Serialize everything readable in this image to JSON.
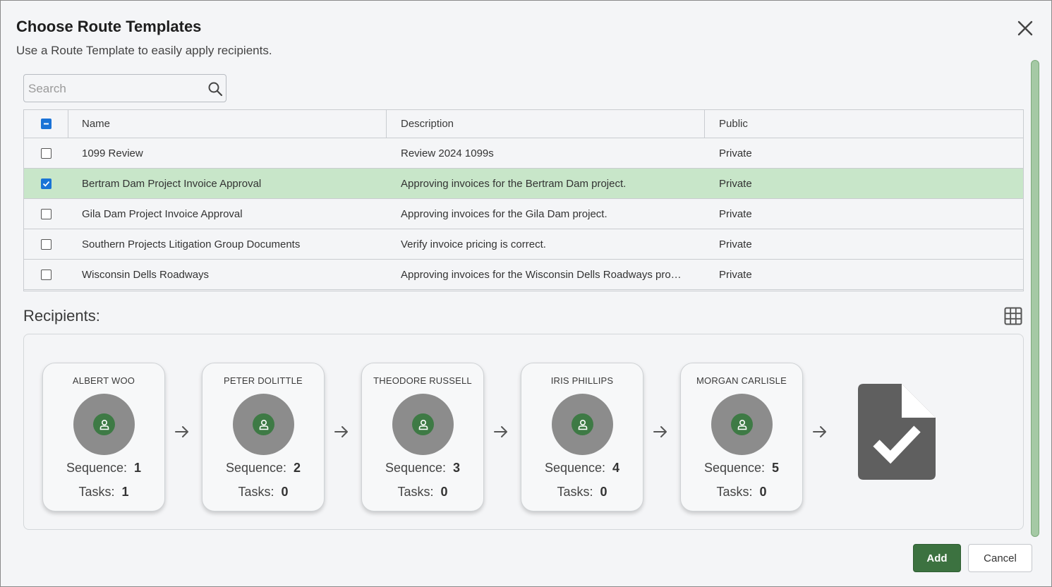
{
  "dialog": {
    "title": "Choose Route Templates",
    "subtitle": "Use a Route Template to easily apply recipients."
  },
  "search": {
    "placeholder": "Search",
    "value": ""
  },
  "table": {
    "columns": [
      "Name",
      "Description",
      "Public"
    ],
    "rows": [
      {
        "name": "1099 Review",
        "description": "Review 2024 1099s",
        "public": "Private",
        "checked": false
      },
      {
        "name": "Bertram Dam Project Invoice Approval",
        "description": "Approving invoices for the Bertram Dam project.",
        "public": "Private",
        "checked": true
      },
      {
        "name": "Gila Dam Project Invoice Approval",
        "description": "Approving invoices for the Gila Dam project.",
        "public": "Private",
        "checked": false
      },
      {
        "name": "Southern Projects Litigation Group Documents",
        "description": "Verify invoice pricing is correct.",
        "public": "Private",
        "checked": false
      },
      {
        "name": "Wisconsin Dells Roadways",
        "description": "Approving invoices for the Wisconsin Dells Roadways pro…",
        "public": "Private",
        "checked": false
      }
    ]
  },
  "recipients": {
    "label": "Recipients:",
    "sequence_label": "Sequence:",
    "tasks_label": "Tasks:",
    "items": [
      {
        "name": "ALBERT WOO",
        "sequence": "1",
        "tasks": "1"
      },
      {
        "name": "PETER DOLITTLE",
        "sequence": "2",
        "tasks": "0"
      },
      {
        "name": "THEODORE RUSSELL",
        "sequence": "3",
        "tasks": "0"
      },
      {
        "name": "IRIS PHILLIPS",
        "sequence": "4",
        "tasks": "0"
      },
      {
        "name": "MORGAN CARLISLE",
        "sequence": "5",
        "tasks": "0"
      }
    ]
  },
  "buttons": {
    "add": "Add",
    "cancel": "Cancel"
  },
  "colors": {
    "accent_green": "#3c7240",
    "selected_row": "#c8e6c9",
    "checkbox_blue": "#1a73d6"
  }
}
